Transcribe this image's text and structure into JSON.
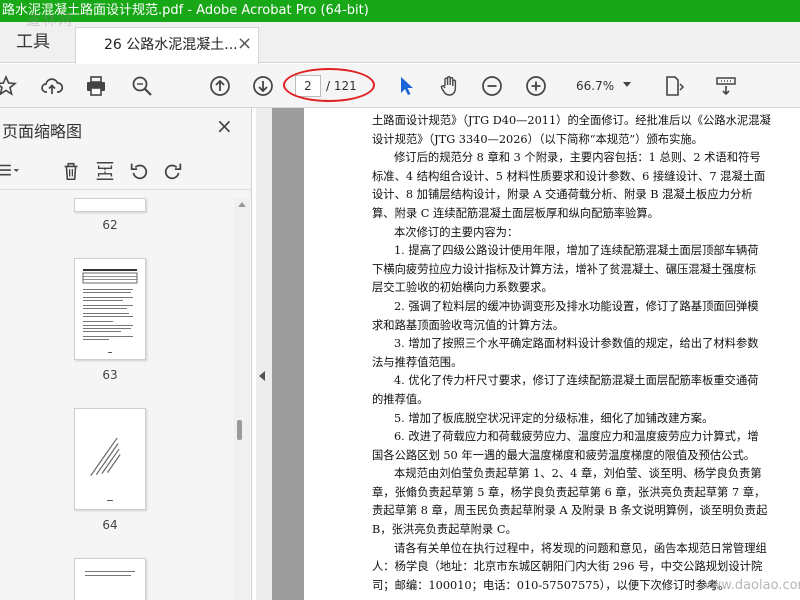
{
  "window": {
    "title": "路水泥混凝土路面设计规范.pdf - Adobe Acrobat Pro (64-bit)"
  },
  "tabs": {
    "tools_label": "工具",
    "document_label": "26 公路水泥混凝土...",
    "close_glyph": "×"
  },
  "toolbar": {
    "icons": [
      "bookmark-star-icon",
      "cloud-upload-icon",
      "print-icon",
      "zoom-search-icon",
      "page-up-icon",
      "page-down-icon",
      "select-cursor-icon",
      "hand-pan-icon",
      "zoom-out-icon",
      "zoom-in-icon",
      "page-layout-icon",
      "scroll-mode-icon"
    ],
    "page_current": "2",
    "page_total": "/ 121",
    "zoom": "66.7%",
    "highlight_color": "#e02020"
  },
  "panel": {
    "title": "页面缩略图",
    "close_glyph": "×",
    "thumbnails": [
      {
        "label": "62"
      },
      {
        "label": "63"
      },
      {
        "label": "64"
      }
    ]
  },
  "document": {
    "lines": [
      "土路面设计规范》（JTG D40—2011）的全面修订。经批准后以《公路水泥混凝",
      "设计规范》（JTG 3340—2026）（以下简称“本规范”）颁布实施。",
      "修订后的规范分 8 章和 3 个附录，主要内容包括：1 总则、2 术语和符号",
      "标准、4 结构组合设计、5 材料性质要求和设计参数、6 接缝设计、7 混凝土面",
      "设计、8 加铺层结构设计，附录 A 交通荷载分析、附录 B 混凝土板应力分析",
      "算、附录 C 连续配筋混凝土面层板厚和纵向配筋率验算。",
      "本次修订的主要内容为：",
      "1. 提高了四级公路设计使用年限，增加了连续配筋混凝土面层顶部车辆荷",
      "下横向疲劳拉应力设计指标及计算方法，增补了贫混凝土、碾压混凝土强度标",
      "层交工验收的初始横向力系数要求。",
      "2. 强调了粒料层的缓冲协调变形及排水功能设置，修订了路基顶面回弹模",
      "求和路基顶面验收弯沉值的计算方法。",
      "3. 增加了按照三个水平确定路面材料设计参数值的规定，给出了材料参数",
      "法与推荐值范围。",
      "4. 优化了传力杆尺寸要求，修订了连续配筋混凝土面层配筋率板重交通荷",
      "的推荐值。",
      "5. 增加了板底脱空状况评定的分级标准，细化了加铺改建方案。",
      "6. 改进了荷载应力和荷载疲劳应力、温度应力和温度疲劳应力计算式，增",
      "国各公路区划 50 年一遇的最大温度梯度和疲劳温度梯度的限值及预估公式。",
      "本规范由刘伯莹负责起草第 1、2、4 章，刘伯莹、谈至明、杨学良负责第",
      "章，张翛负责起草第 5 章，杨学良负责起草第 6 章，张洪亮负责起草第 7 章，",
      "责起草第 8 章，周玉民负责起草附录 A 及附录 B 条文说明算例，谈至明负责起",
      "B，张洪亮负责起草附录 C。",
      "请各有关单位在执行过程中，将发现的问题和意见，函告本规范日常管理组",
      "人：杨学良（地址：北京市东城区朝阳门内大街 296 号，中交公路规划设计院",
      "司；邮编：100010；电话：010-57507575），以便下次修订时参考。"
    ]
  },
  "watermarks": {
    "top_left": "道林网",
    "bottom_right": "www.daolao.com"
  },
  "colors": {
    "titlebar": "#17a717",
    "accent_blue": "#1b64d8"
  }
}
